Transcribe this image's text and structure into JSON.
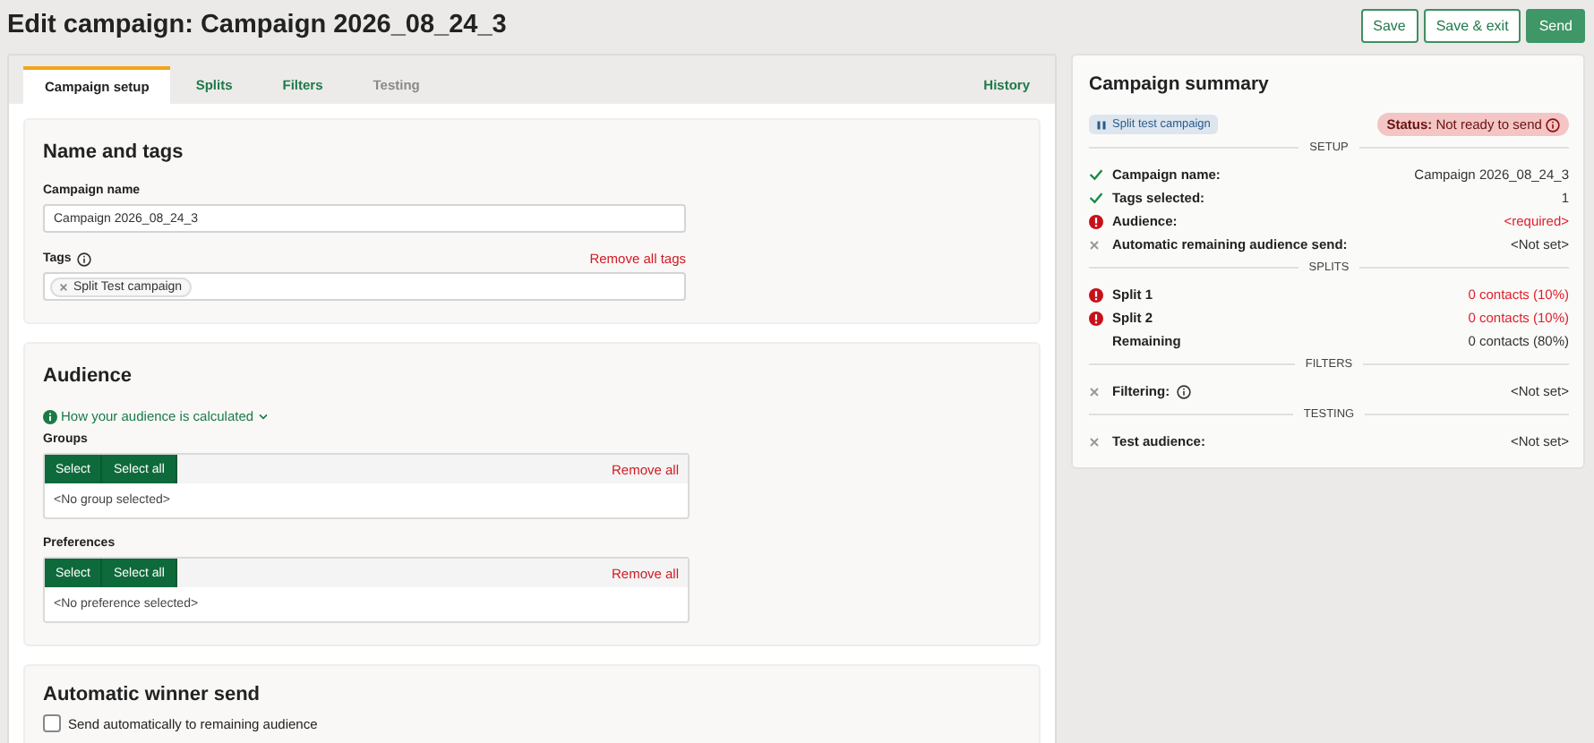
{
  "page_title": "Edit campaign: Campaign 2026_08_24_3",
  "actions": [
    {
      "label": "Save",
      "kind": "outline"
    },
    {
      "label": "Save & exit",
      "kind": "outline"
    },
    {
      "label": "Send",
      "kind": "primary"
    }
  ],
  "tabs": [
    {
      "label": "Campaign setup",
      "selected": true,
      "disabled": false
    },
    {
      "label": "Splits",
      "selected": false,
      "disabled": false
    },
    {
      "label": "Filters",
      "selected": false,
      "disabled": false
    },
    {
      "label": "Testing",
      "selected": false,
      "disabled": true
    }
  ],
  "history_link": "History",
  "name_and_tags": {
    "heading": "Name and tags",
    "name_label": "Campaign name",
    "name_value": "Campaign 2026_08_24_3",
    "tags_label": "Tags",
    "remove_all_tags": "Remove all tags",
    "tags": [
      "Split Test campaign"
    ]
  },
  "audience": {
    "heading": "Audience",
    "info_link": "How your audience is calculated",
    "pickers": [
      {
        "label": "Groups",
        "select": "Select",
        "select_all": "Select all",
        "remove_all": "Remove all",
        "empty": "<No group selected>"
      },
      {
        "label": "Preferences",
        "select": "Select",
        "select_all": "Select all",
        "remove_all": "Remove all",
        "empty": "<No preference selected>"
      }
    ]
  },
  "winner": {
    "heading": "Automatic winner send",
    "checkbox_label": "Send automatically to remaining audience",
    "checked": false
  },
  "summary": {
    "title": "Campaign summary",
    "type_badge": "Split test campaign",
    "status_label": "Status:",
    "status_value": "Not ready to send",
    "sections": [
      {
        "heading": "SETUP",
        "rows": [
          {
            "label": "Campaign name:",
            "value": "Campaign 2026_08_24_3",
            "kind": "ok",
            "info": false
          },
          {
            "label": "Tags selected:",
            "value": "1",
            "kind": "ok",
            "info": false
          },
          {
            "label": "Audience:",
            "value": "<required>",
            "kind": "error",
            "info": false
          },
          {
            "label": "Automatic remaining audience send:",
            "value": "<Not set>",
            "kind": "unset",
            "info": false
          }
        ]
      },
      {
        "heading": "SPLITS",
        "rows": [
          {
            "label": "Split 1",
            "value": "0 contacts (10%)",
            "kind": "error",
            "info": false
          },
          {
            "label": "Split 2",
            "value": "0 contacts (10%)",
            "kind": "error",
            "info": false
          },
          {
            "label": "Remaining",
            "value": "0 contacts (80%)",
            "kind": "none",
            "info": false
          }
        ]
      },
      {
        "heading": "FILTERS",
        "rows": [
          {
            "label": "Filtering:",
            "value": "<Not set>",
            "kind": "unset",
            "info": true
          }
        ]
      },
      {
        "heading": "TESTING",
        "rows": [
          {
            "label": "Test audience:",
            "value": "<Not set>",
            "kind": "unset",
            "info": false
          }
        ]
      }
    ]
  }
}
